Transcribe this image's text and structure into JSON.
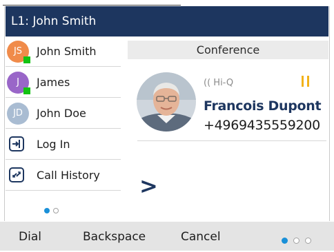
{
  "titlebar": {
    "title": "L1: John Smith"
  },
  "sidebar": {
    "items": [
      {
        "type": "contact",
        "initials": "JS",
        "label": "John Smith",
        "avatar_color": "#f08b4a",
        "presence": true
      },
      {
        "type": "contact",
        "initials": "J",
        "label": "James",
        "avatar_color": "#9966c8",
        "presence": true
      },
      {
        "type": "contact",
        "initials": "JD",
        "label": "John Doe",
        "avatar_color": "#a9bcd2",
        "presence": false
      },
      {
        "type": "action",
        "icon": "login-icon",
        "label": "Log In"
      },
      {
        "type": "action",
        "icon": "call-history-icon",
        "label": "Call History"
      }
    ],
    "page_indicator": {
      "current": 1,
      "total": 2
    }
  },
  "call": {
    "header": "Conference",
    "codec_badge": "Hi-Q",
    "hold_icon": "pause-icon",
    "caller_name": "Francois Dupont",
    "caller_number": "+4969435559200",
    "entry_prompt": ">"
  },
  "softkeys": {
    "labels": [
      "Dial",
      "Backspace",
      "Cancel"
    ],
    "page_indicator": {
      "current": 1,
      "total": 3
    }
  },
  "colors": {
    "titlebar_bg": "#1d365f",
    "accent_blue": "#1a90d8",
    "hold_yellow": "#f2b21a",
    "presence_green": "#13c313"
  }
}
